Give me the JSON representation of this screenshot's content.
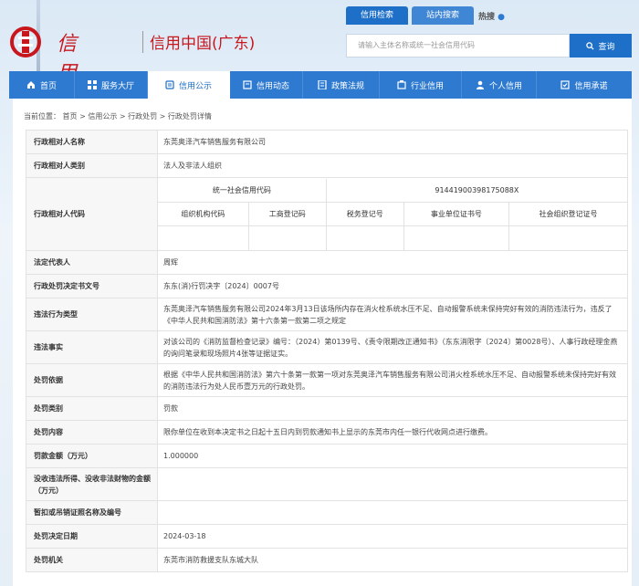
{
  "header": {
    "logo_calligraphy": "信用广东",
    "logo_text": "信用中国(广东)",
    "search_tabs": [
      "信用检索",
      "站内搜索"
    ],
    "hot_label": "热搜",
    "search_placeholder": "请输入主体名称或统一社会信用代码",
    "search_button": "查询"
  },
  "nav": {
    "items": [
      "首页",
      "服务大厅",
      "信用公示",
      "信用动态",
      "政策法规",
      "行业信用",
      "个人信用",
      "信用承诺"
    ]
  },
  "breadcrumb": "当前位置： 首页 > 信用公示 > 行政处罚 > 行政处罚详情",
  "detail": {
    "rows": [
      {
        "label": "行政相对人名称",
        "value": "东莞奥泽汽车销售服务有限公司"
      },
      {
        "label": "行政相对人类别",
        "value": "法人及非法人组织"
      },
      {
        "label": "法定代表人",
        "value": "周辉"
      },
      {
        "label": "行政处罚决定书文号",
        "value": "东东(消)行罚决字〔2024〕0007号"
      },
      {
        "label": "违法行为类型",
        "value": "东莞奥泽汽车销售服务有限公司2024年3月13日该场所内存在消火栓系统水压不足、自动报警系统未保持完好有效的消防违法行为，违反了《中华人民共和国消防法》第十六条第一款第二项之规定"
      },
      {
        "label": "违法事实",
        "value": "对该公司的《消防监督检查记录》编号：（2024）第0139号、《责令限期改正通知书》（东东消限字〔2024〕第0028号）、人事行政经理金燕的询问笔录和现场照片4张等证据证实。"
      },
      {
        "label": "处罚依据",
        "value": "根据《中华人民共和国消防法》第六十条第一款第一项对东莞奥泽汽车销售服务有限公司消火栓系统水压不足、自动报警系统未保持完好有效的消防违法行为处人民币壹万元的行政处罚。"
      },
      {
        "label": "处罚类别",
        "value": "罚款"
      },
      {
        "label": "处罚内容",
        "value": "限你单位在收到本决定书之日起十五日内到罚款通知书上显示的东莞市内任一银行代收网点进行缴费。"
      },
      {
        "label": "罚款金额（万元）",
        "value": "1.000000"
      },
      {
        "label": "没收违法所得、没收非法财物的金额（万元）",
        "value": ""
      },
      {
        "label": "暂扣或吊销证照名称及编号",
        "value": ""
      },
      {
        "label": "处罚决定日期",
        "value": "2024-03-18"
      },
      {
        "label": "处罚机关",
        "value": "东莞市消防救援支队东城大队"
      }
    ],
    "code_label": "行政相对人代码",
    "code_headers": [
      "统一社会信用代码",
      "91441900398175088X"
    ],
    "code_sub_headers": [
      "组织机构代码",
      "工商登记码",
      "税务登记号",
      "事业单位证书号",
      "社会组织登记证号"
    ]
  },
  "colors": {
    "primary": "#1d6fc7",
    "brand_red": "#c8161d"
  }
}
